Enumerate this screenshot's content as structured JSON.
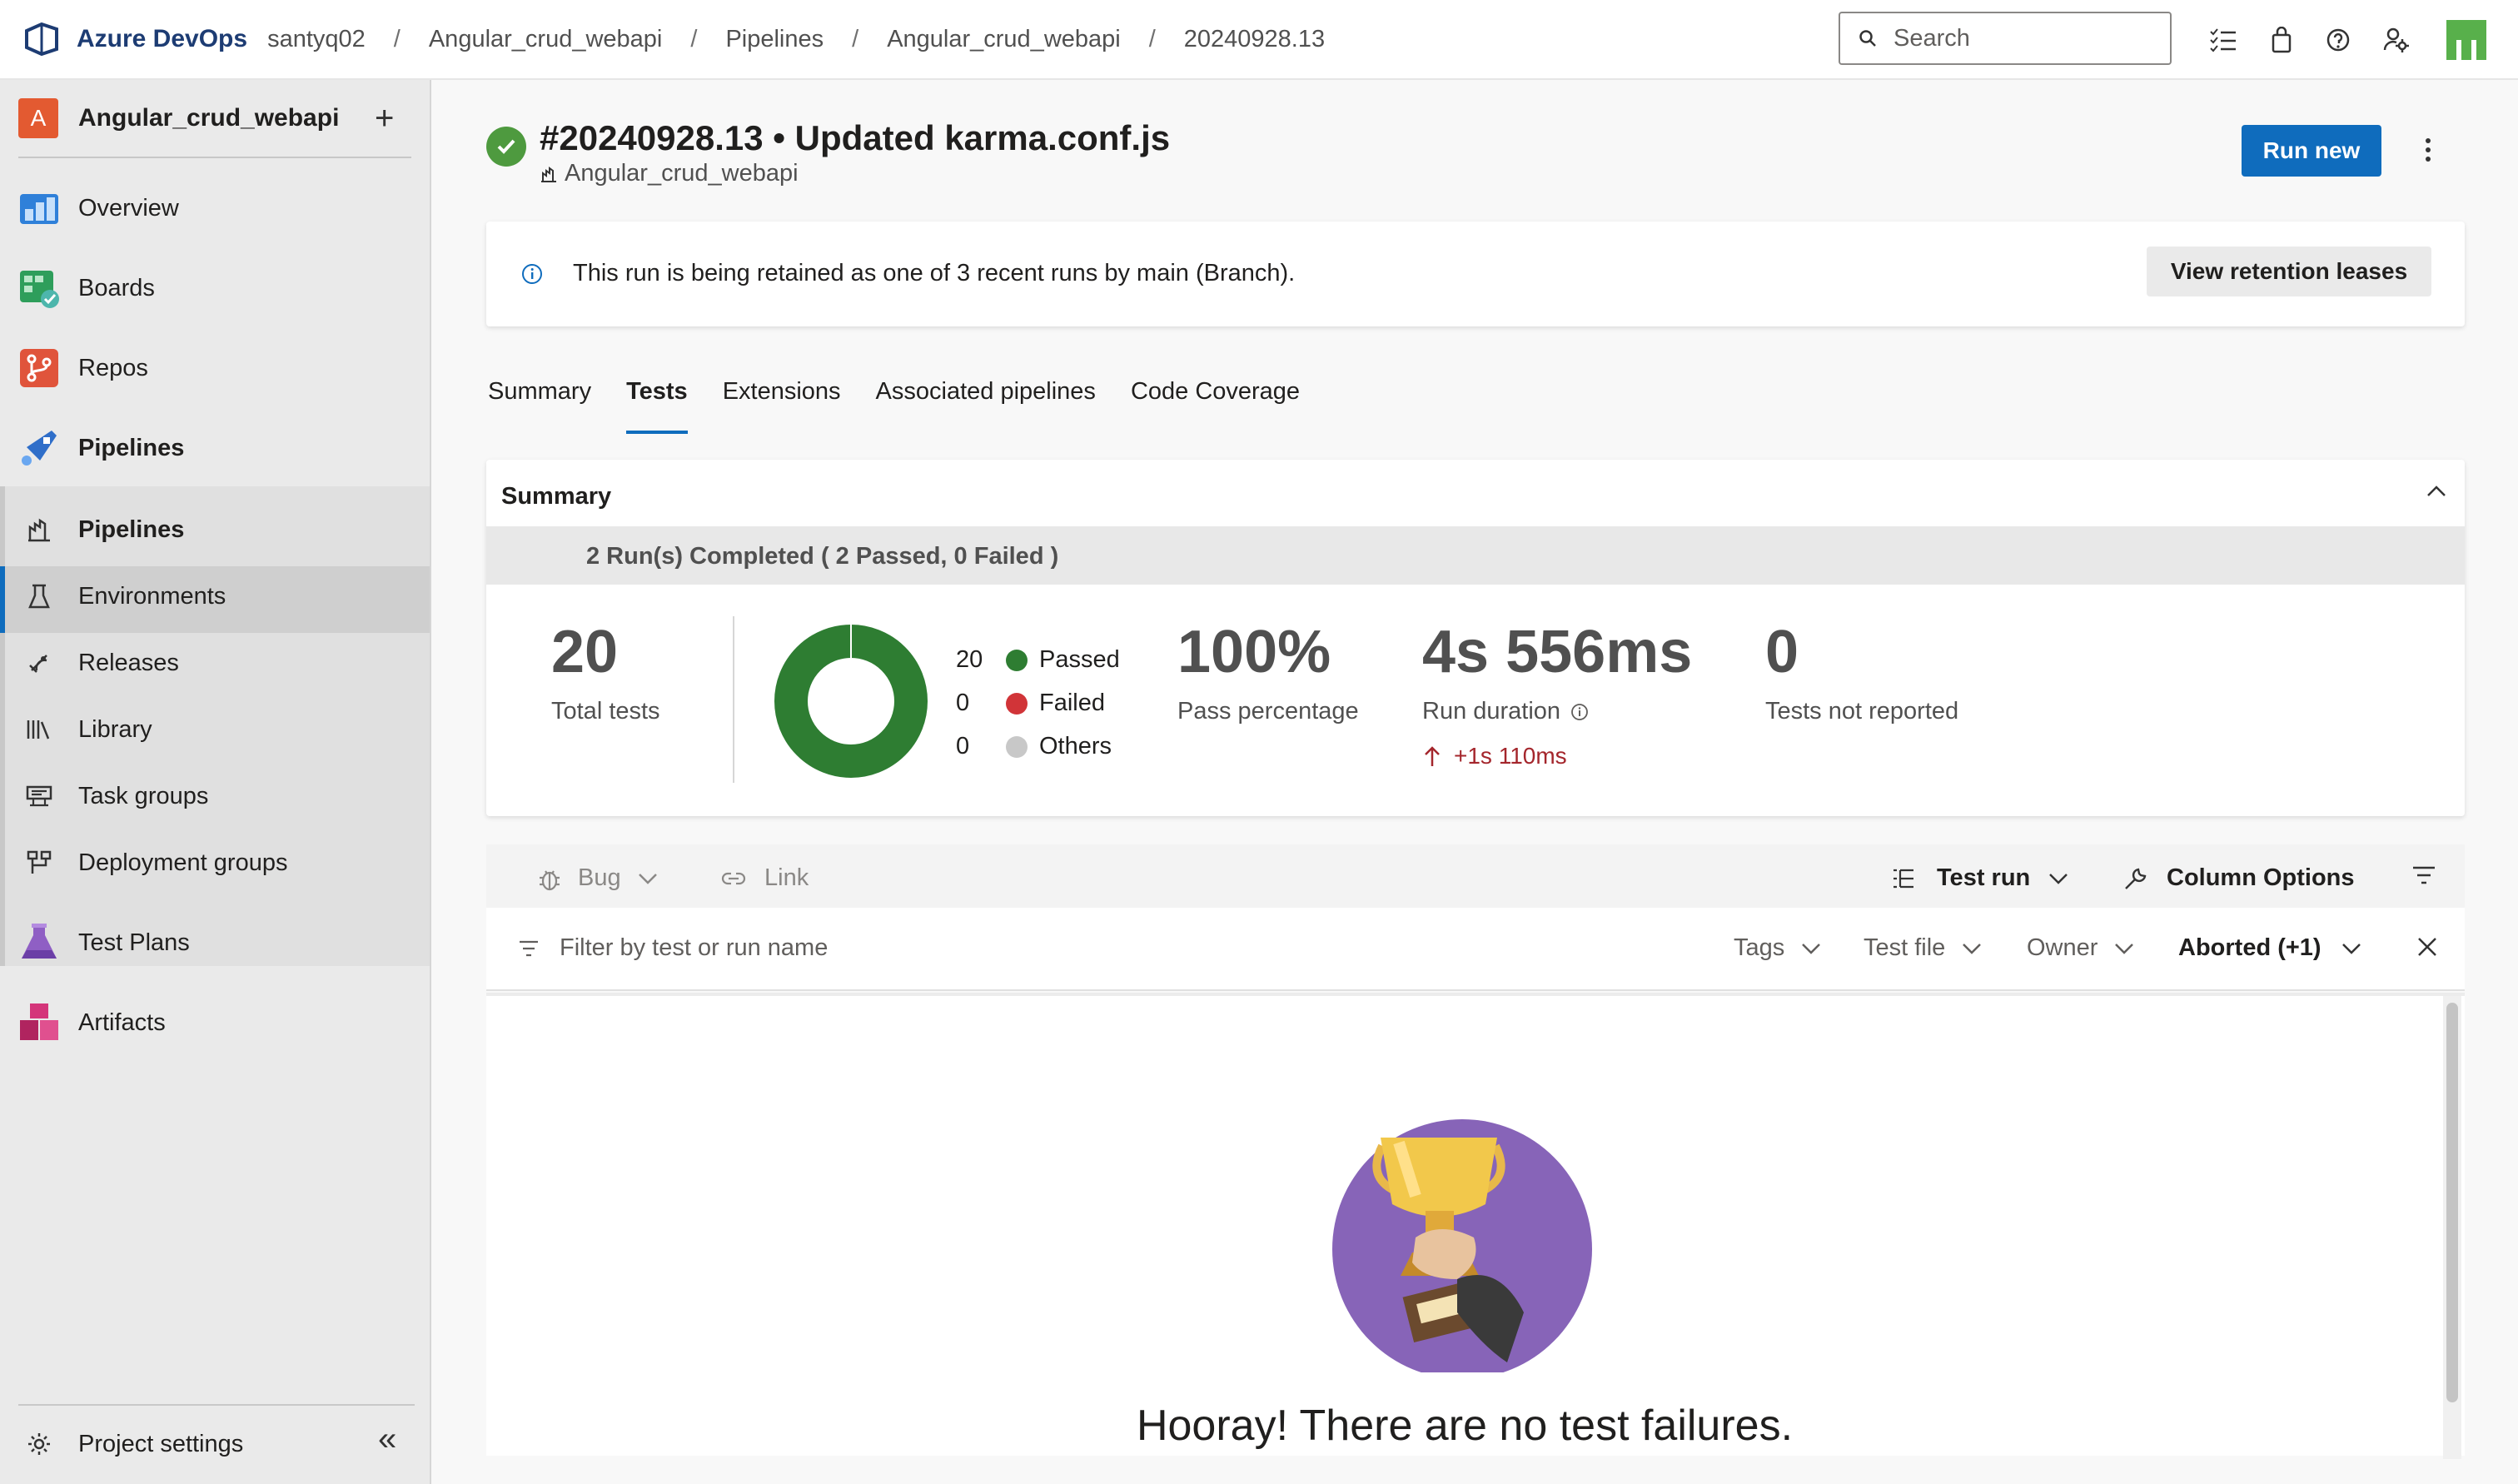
{
  "topbar": {
    "brand": "Azure DevOps",
    "breadcrumbs": [
      "santyq02",
      "Angular_crud_webapi",
      "Pipelines",
      "Angular_crud_webapi",
      "20240928.13"
    ],
    "separator": "/",
    "search_placeholder": "Search",
    "icons": [
      "task-list-icon",
      "shopping-bag-icon",
      "help-icon",
      "user-settings-icon",
      "user-avatar"
    ]
  },
  "sidebar": {
    "project_initial": "A",
    "project_name": "Angular_crud_webapi",
    "add_symbol": "+",
    "items": [
      {
        "label": "Overview",
        "icon": "overview-icon"
      },
      {
        "label": "Boards",
        "icon": "boards-icon"
      },
      {
        "label": "Repos",
        "icon": "repos-icon"
      },
      {
        "label": "Pipelines",
        "icon": "pipelines-icon"
      },
      {
        "label": "Test Plans",
        "icon": "test-plans-icon"
      },
      {
        "label": "Artifacts",
        "icon": "artifacts-icon"
      }
    ],
    "pipeline_sub_items": [
      {
        "label": "Pipelines",
        "icon": "pipeline-sub-icon"
      },
      {
        "label": "Environments",
        "icon": "environments-icon"
      },
      {
        "label": "Releases",
        "icon": "releases-icon"
      },
      {
        "label": "Library",
        "icon": "library-icon"
      },
      {
        "label": "Task groups",
        "icon": "task-groups-icon"
      },
      {
        "label": "Deployment groups",
        "icon": "deployment-groups-icon"
      }
    ],
    "project_settings": "Project settings",
    "collapse_symbol": "«"
  },
  "run": {
    "title": "#20240928.13 • Updated karma.conf.js",
    "pipeline_name": "Angular_crud_webapi",
    "status": "succeeded",
    "run_new_label": "Run new"
  },
  "banner": {
    "text": "This run is being retained as one of 3 recent runs by main (Branch).",
    "button_label": "View retention leases"
  },
  "tabs": [
    {
      "label": "Summary",
      "active": false
    },
    {
      "label": "Tests",
      "active": true
    },
    {
      "label": "Extensions",
      "active": false
    },
    {
      "label": "Associated pipelines",
      "active": false
    },
    {
      "label": "Code Coverage",
      "active": false
    }
  ],
  "summary": {
    "heading": "Summary",
    "strip_text": "2 Run(s) Completed ( 2 Passed, 0 Failed )",
    "total_tests": "20",
    "total_tests_label": "Total tests",
    "legend": [
      {
        "count": "20",
        "label": "Passed",
        "color": "#2e7d32"
      },
      {
        "count": "0",
        "label": "Failed",
        "color": "#d13438"
      },
      {
        "count": "0",
        "label": "Others",
        "color": "#c8c8c8"
      }
    ],
    "pass_percentage": "100%",
    "pass_percentage_label": "Pass percentage",
    "run_duration": "4s 556ms",
    "run_duration_label": "Run duration",
    "duration_delta": "+1s 110ms",
    "not_reported": "0",
    "not_reported_label": "Tests not reported"
  },
  "chart_data": {
    "type": "pie",
    "categories": [
      "Passed",
      "Failed",
      "Others"
    ],
    "values": [
      20,
      0,
      0
    ],
    "colors": [
      "#2e7d32",
      "#d13438",
      "#c8c8c8"
    ],
    "title": ""
  },
  "toolbar": {
    "bug_label": "Bug",
    "link_label": "Link",
    "test_run_label": "Test run",
    "column_options_label": "Column Options"
  },
  "filters": {
    "filter_placeholder": "Filter by test or run name",
    "tags_label": "Tags",
    "test_file_label": "Test file",
    "owner_label": "Owner",
    "outcome_label": "Aborted (+1)"
  },
  "results": {
    "empty_message": "Hooray! There are no test failures."
  },
  "colors": {
    "accent": "#0f6cbd",
    "success": "#4e9a3f",
    "brand": "#1d3c73"
  }
}
